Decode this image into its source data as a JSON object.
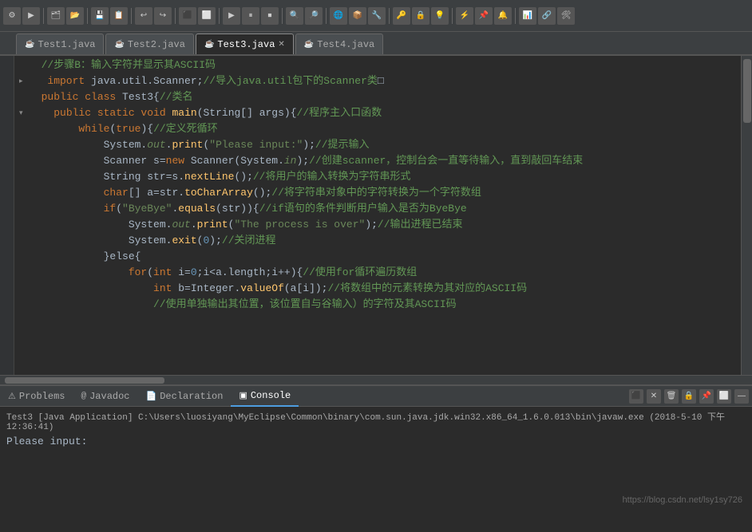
{
  "toolbar": {
    "icons": [
      "⚙",
      "▶",
      "⬛",
      "⏸",
      "🔧",
      "📋",
      "📄",
      "💾",
      "↩",
      "↪",
      "🔍",
      "🔎",
      "⬆",
      "⬇",
      "◀",
      "▶",
      "⬜",
      "🔲",
      "📦",
      "🌐",
      "🔷",
      "▶",
      "⏹",
      "⏸",
      "📌",
      "🔑",
      "📊",
      "📈",
      "🔔",
      "⚡",
      "🔒",
      "🔓",
      "🛠",
      "📁",
      "📂",
      "💡",
      "🔗"
    ]
  },
  "tabs": [
    {
      "id": "tab1",
      "label": "Test1.java",
      "active": false,
      "closable": false
    },
    {
      "id": "tab2",
      "label": "Test2.java",
      "active": false,
      "closable": false
    },
    {
      "id": "tab3",
      "label": "Test3.java",
      "active": true,
      "closable": true
    },
    {
      "id": "tab4",
      "label": "Test4.java",
      "active": false,
      "closable": false
    }
  ],
  "code": [
    {
      "indent": 0,
      "expandable": false,
      "content_html": "<span class='c-comment'>&nbsp;&nbsp;//步骤B：输入字符并显示其ASCII码</span>"
    },
    {
      "indent": 0,
      "expandable": true,
      "content_html": "<span class='c-plain'>&nbsp;&nbsp;&nbsp;&nbsp;</span><span class='c-keyword'>import</span><span class='c-plain'> java.util.Scanner;</span><span class='c-comment'>//导入java.util包下的Scanner类</span><span class='c-plain'>□</span>"
    },
    {
      "indent": 0,
      "expandable": false,
      "content_html": "<span class='c-plain'>&nbsp;&nbsp;</span><span class='c-keyword'>public class</span><span class='c-plain'> Test3{</span><span class='c-comment'>//类名</span>"
    },
    {
      "indent": 0,
      "expandable": true,
      "content_html": "<span class='c-plain'>&nbsp;&nbsp;&nbsp;&nbsp;</span><span class='c-keyword'>public static void</span><span class='c-plain'> </span><span class='c-method'>main</span><span class='c-plain'>(String[] args){</span><span class='c-comment'>//程序主入口函数</span>"
    },
    {
      "indent": 0,
      "expandable": false,
      "content_html": "<span class='c-plain'>&nbsp;&nbsp;&nbsp;&nbsp;&nbsp;&nbsp;&nbsp;&nbsp;</span><span class='c-keyword'>while</span><span class='c-plain'>(</span><span class='c-keyword'>true</span><span class='c-plain'>){</span><span class='c-comment'>//定义死循环</span>"
    },
    {
      "indent": 0,
      "expandable": false,
      "content_html": "<span class='c-plain'>&nbsp;&nbsp;&nbsp;&nbsp;&nbsp;&nbsp;&nbsp;&nbsp;&nbsp;&nbsp;&nbsp;&nbsp;System.</span><span class='c-italic'>out</span><span class='c-plain'>.</span><span class='c-method'>print</span><span class='c-plain'>(</span><span class='c-string'>\"Please input:\"</span><span class='c-plain'>);</span><span class='c-comment'>//提示输入</span>"
    },
    {
      "indent": 0,
      "expandable": false,
      "content_html": "<span class='c-plain'>&nbsp;&nbsp;&nbsp;&nbsp;&nbsp;&nbsp;&nbsp;&nbsp;&nbsp;&nbsp;&nbsp;&nbsp;Scanner s=</span><span class='c-keyword'>new</span><span class='c-plain'> Scanner(System.</span><span class='c-italic'>in</span><span class='c-plain'>);</span><span class='c-comment'>//创建scanner，控制台会一直等待输入，直到敲回车结束</span>"
    },
    {
      "indent": 0,
      "expandable": false,
      "content_html": "<span class='c-plain'>&nbsp;&nbsp;&nbsp;&nbsp;&nbsp;&nbsp;&nbsp;&nbsp;&nbsp;&nbsp;&nbsp;&nbsp;String str=s.</span><span class='c-method'>nextLine</span><span class='c-plain'>();</span><span class='c-comment'>//将用户的输入转换为字符串形式</span>"
    },
    {
      "indent": 0,
      "expandable": false,
      "content_html": "<span class='c-plain'>&nbsp;&nbsp;&nbsp;&nbsp;&nbsp;&nbsp;&nbsp;&nbsp;&nbsp;&nbsp;&nbsp;&nbsp;</span><span class='c-keyword'>char</span><span class='c-plain'>[] a=str.</span><span class='c-method'>toCharArray</span><span class='c-plain'>();</span><span class='c-comment'>//将字符串对象中的字符转换为一个字符数组</span>"
    },
    {
      "indent": 0,
      "expandable": false,
      "content_html": "<span class='c-plain'>&nbsp;&nbsp;&nbsp;&nbsp;&nbsp;&nbsp;&nbsp;&nbsp;&nbsp;&nbsp;&nbsp;&nbsp;</span><span class='c-keyword'>if</span><span class='c-plain'>(</span><span class='c-string'>\"ByeBye\"</span><span class='c-plain'>.</span><span class='c-method'>equals</span><span class='c-plain'>(str)){</span><span class='c-comment'>//if语句的条件判断用户输入是否为ByeBye</span>"
    },
    {
      "indent": 0,
      "expandable": false,
      "content_html": "<span class='c-plain'>&nbsp;&nbsp;&nbsp;&nbsp;&nbsp;&nbsp;&nbsp;&nbsp;&nbsp;&nbsp;&nbsp;&nbsp;&nbsp;&nbsp;&nbsp;&nbsp;System.</span><span class='c-italic'>out</span><span class='c-plain'>.</span><span class='c-method'>print</span><span class='c-plain'>(</span><span class='c-string'>\"The process is over\"</span><span class='c-plain'>);</span><span class='c-comment'>//输出进程已结束</span>"
    },
    {
      "indent": 0,
      "expandable": false,
      "content_html": "<span class='c-plain'>&nbsp;&nbsp;&nbsp;&nbsp;&nbsp;&nbsp;&nbsp;&nbsp;&nbsp;&nbsp;&nbsp;&nbsp;&nbsp;&nbsp;&nbsp;&nbsp;System.</span><span class='c-method'>exit</span><span class='c-plain'>(</span><span class='c-number'>0</span><span class='c-plain'>);</span><span class='c-comment'>//关闭进程</span>"
    },
    {
      "indent": 0,
      "expandable": false,
      "content_html": "<span class='c-plain'>&nbsp;&nbsp;&nbsp;&nbsp;&nbsp;&nbsp;&nbsp;&nbsp;&nbsp;&nbsp;&nbsp;&nbsp;}else{</span>"
    },
    {
      "indent": 0,
      "expandable": false,
      "content_html": "<span class='c-plain'>&nbsp;&nbsp;&nbsp;&nbsp;&nbsp;&nbsp;&nbsp;&nbsp;&nbsp;&nbsp;&nbsp;&nbsp;&nbsp;&nbsp;&nbsp;&nbsp;</span><span class='c-keyword'>for</span><span class='c-plain'>(</span><span class='c-keyword'>int</span><span class='c-plain'> i=</span><span class='c-number'>0</span><span class='c-plain'>;i&lt;a.length;i++){</span><span class='c-comment'>//使用for循环遍历数组</span>"
    },
    {
      "indent": 0,
      "expandable": false,
      "content_html": "<span class='c-plain'>&nbsp;&nbsp;&nbsp;&nbsp;&nbsp;&nbsp;&nbsp;&nbsp;&nbsp;&nbsp;&nbsp;&nbsp;&nbsp;&nbsp;&nbsp;&nbsp;&nbsp;&nbsp;&nbsp;&nbsp;</span><span class='c-keyword'>int</span><span class='c-plain'> b=Integer.</span><span class='c-method'>valueOf</span><span class='c-plain'>(a[i]);</span><span class='c-comment'>//将数组中的元素转换为其对应的ASCII码</span>"
    },
    {
      "indent": 0,
      "expandable": false,
      "content_html": "<span class='c-plain'>&nbsp;&nbsp;&nbsp;&nbsp;&nbsp;&nbsp;&nbsp;&nbsp;&nbsp;&nbsp;&nbsp;&nbsp;&nbsp;&nbsp;&nbsp;&nbsp;&nbsp;&nbsp;&nbsp;&nbsp;</span><span class='c-comment'>//使用单独输出其位置，该位置自与谷输入）的字符及其ASCII码</span>"
    }
  ],
  "bottom_tabs": [
    {
      "id": "problems",
      "label": "Problems",
      "active": false,
      "icon": "⚠"
    },
    {
      "id": "javadoc",
      "label": "Javadoc",
      "active": false,
      "icon": "@"
    },
    {
      "id": "declaration",
      "label": "Declaration",
      "active": false,
      "icon": "📄"
    },
    {
      "id": "console",
      "label": "Console",
      "active": true,
      "icon": "▣"
    }
  ],
  "console": {
    "path": "Test3 [Java Application] C:\\Users\\luosiyang\\MyEclipse\\Common\\binary\\com.sun.java.jdk.win32.x86_64_1.6.0.013\\bin\\javaw.exe (2018-5-10 下午12:36:41)",
    "output": "Please input:"
  },
  "watermark": "https://blog.csdn.net/lsy1sy726"
}
